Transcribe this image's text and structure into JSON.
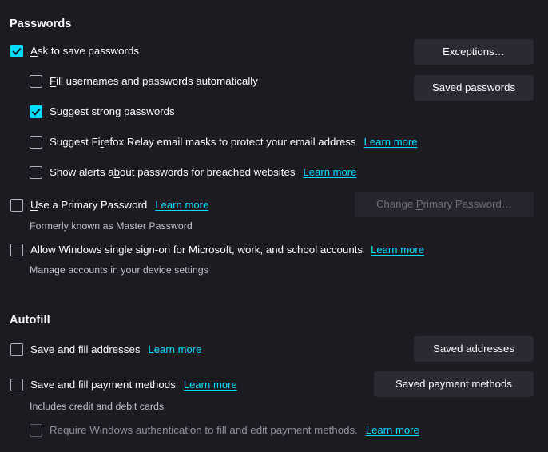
{
  "passwords": {
    "heading": "Passwords",
    "ask_to_save": {
      "label_pre": "",
      "accesskey": "A",
      "label_post": "sk to save passwords",
      "checked": true
    },
    "fill_automatically": {
      "label_pre": "",
      "accesskey": "F",
      "label_post": "ill usernames and passwords automatically",
      "checked": false
    },
    "suggest_strong": {
      "label_pre": "",
      "accesskey": "S",
      "label_post": "uggest strong passwords",
      "checked": true
    },
    "firefox_relay": {
      "label_pre": "Suggest Fi",
      "accesskey": "r",
      "label_post": "efox Relay email masks to protect your email address",
      "checked": false,
      "learn_more": "Learn more"
    },
    "breach_alerts": {
      "label_pre": "Show alerts a",
      "accesskey": "b",
      "label_post": "out passwords for breached websites",
      "checked": false,
      "learn_more": "Learn more"
    },
    "primary_password": {
      "label_pre": "",
      "accesskey": "U",
      "label_post": "se a Primary Password",
      "checked": false,
      "learn_more": "Learn more",
      "subtext": "Formerly known as Master Password"
    },
    "windows_sso": {
      "label": "Allow Windows single sign-on for Microsoft, work, and school accounts",
      "checked": false,
      "learn_more": "Learn more",
      "subtext": "Manage accounts in your device settings"
    },
    "exceptions_button": {
      "label_pre": "E",
      "accesskey": "x",
      "label_post": "ceptions…",
      "disabled": false
    },
    "saved_passwords_button": {
      "label_pre": "Save",
      "accesskey": "d",
      "label_post": " passwords",
      "disabled": false
    },
    "change_primary_password_button": {
      "label_pre": "Change ",
      "accesskey": "P",
      "label_post": "rimary Password…",
      "disabled": true
    }
  },
  "autofill": {
    "heading": "Autofill",
    "save_addresses": {
      "label": "Save and fill addresses",
      "checked": false,
      "learn_more": "Learn more"
    },
    "save_payment_methods": {
      "label": "Save and fill payment methods",
      "checked": false,
      "learn_more": "Learn more",
      "subtext": "Includes credit and debit cards"
    },
    "require_windows_auth": {
      "label": "Require Windows authentication to fill and edit payment methods.",
      "checked": false,
      "disabled": true,
      "learn_more": "Learn more"
    },
    "saved_addresses_button": {
      "label": "Saved addresses"
    },
    "saved_payment_methods_button": {
      "label": "Saved payment methods"
    }
  },
  "colors": {
    "background": "#1c1b22",
    "accent": "#00ddff",
    "button_bg": "#2b2a33",
    "text": "#fbfbfe",
    "muted_text": "#bfbfc9",
    "disabled_text": "#8f8f9d"
  }
}
